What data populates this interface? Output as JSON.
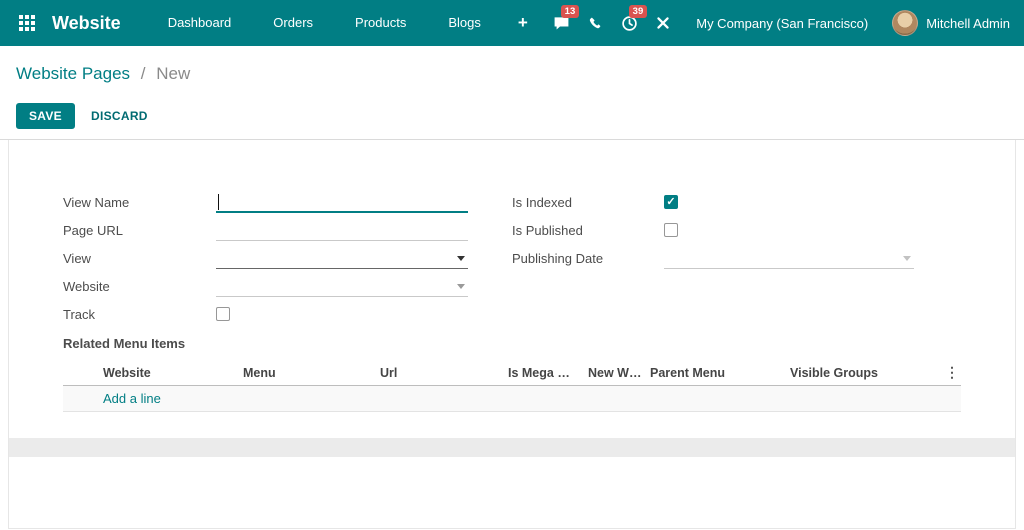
{
  "navbar": {
    "app_name": "Website",
    "menu": [
      "Dashboard",
      "Orders",
      "Products",
      "Blogs"
    ],
    "plus": "+",
    "messages_badge": "13",
    "activities_badge": "39",
    "company": "My Company (San Francisco)",
    "user": "Mitchell Admin"
  },
  "breadcrumb": {
    "parent": "Website Pages",
    "separator": "/",
    "current": "New"
  },
  "controls": {
    "save": "SAVE",
    "discard": "DISCARD"
  },
  "form": {
    "fields_left": [
      {
        "label": "View Name",
        "type": "text",
        "value": "",
        "state": "focused"
      },
      {
        "label": "Page URL",
        "type": "text",
        "value": ""
      },
      {
        "label": "View",
        "type": "select",
        "value": ""
      },
      {
        "label": "Website",
        "type": "select",
        "value": ""
      },
      {
        "label": "Track",
        "type": "checkbox",
        "checked": false
      }
    ],
    "fields_right": [
      {
        "label": "Is Indexed",
        "type": "checkbox",
        "checked": true
      },
      {
        "label": "Is Published",
        "type": "checkbox",
        "checked": false
      },
      {
        "label": "Publishing Date",
        "type": "date",
        "value": ""
      }
    ],
    "section_title": "Related Menu Items"
  },
  "table": {
    "headers": [
      "Website",
      "Menu",
      "Url",
      "Is Mega …",
      "New W…",
      "Parent Menu",
      "Visible Groups"
    ],
    "add_line": "Add a line",
    "options_icon": "⋮"
  },
  "colors": {
    "primary": "#017e84",
    "navbar_bg": "#017e84",
    "badge": "#d9534f",
    "band": "#ebebeb"
  }
}
